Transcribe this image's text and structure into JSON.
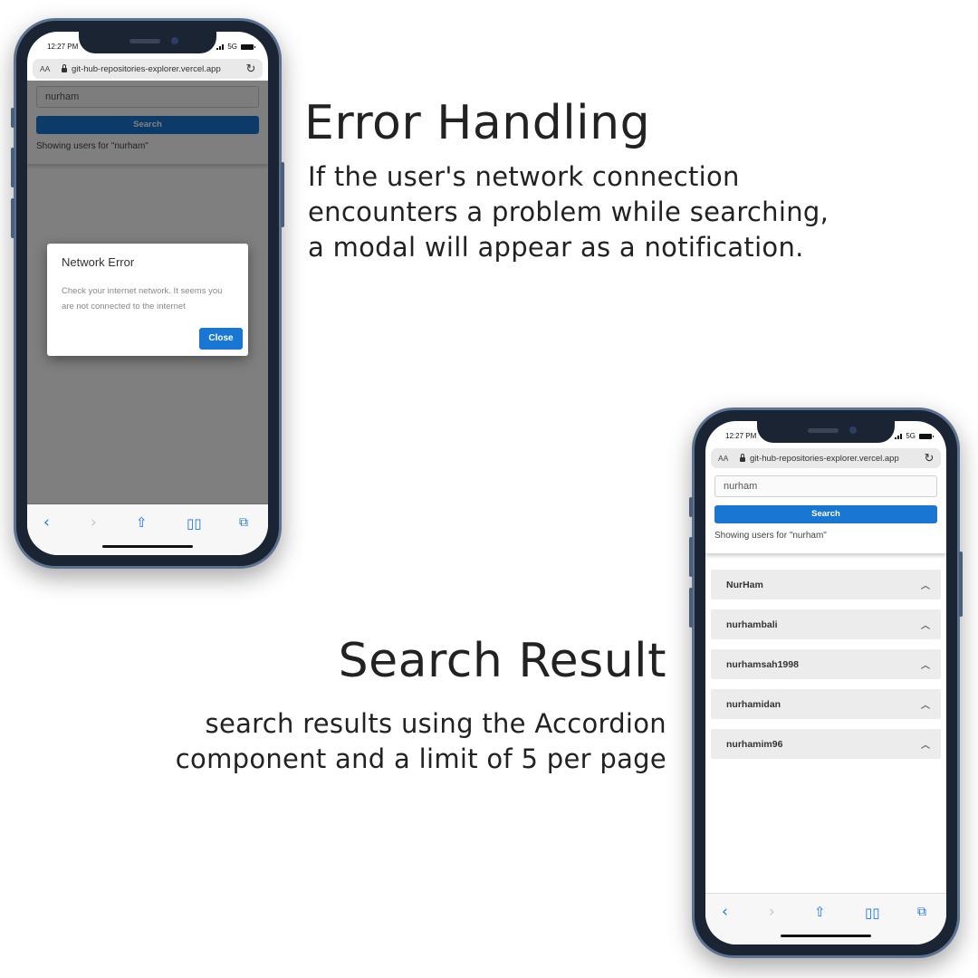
{
  "error_section": {
    "title": "Error Handling",
    "description": "If the user's network connection encounters a problem while searching, a modal will appear as a notification."
  },
  "result_section": {
    "title": "Search Result",
    "description": "search results using the Accordion component and a limit of 5 per page"
  },
  "phone_error": {
    "status": {
      "time": "12:27 PM",
      "network": "5G"
    },
    "browser": {
      "aa": "AA",
      "url": "git-hub-repositories-explorer.vercel.app"
    },
    "search": {
      "value": "nurham",
      "button_label": "Search",
      "showing": "Showing users for \"nurham\""
    },
    "modal": {
      "title": "Network Error",
      "body": "Check your internet network. It seems you are not connected to the internet",
      "close_label": "Close"
    }
  },
  "phone_result": {
    "status": {
      "time": "12:27 PM",
      "network": "5G"
    },
    "browser": {
      "aa": "AA",
      "url": "git-hub-repositories-explorer.vercel.app"
    },
    "search": {
      "value": "nurham",
      "button_label": "Search",
      "showing": "Showing users for \"nurham\""
    },
    "results": [
      {
        "label": "NurHam"
      },
      {
        "label": "nurhambali"
      },
      {
        "label": "nurhamsah1998"
      },
      {
        "label": "nurhamidan"
      },
      {
        "label": "nurhamim96"
      }
    ]
  },
  "icons": {
    "back": "chevron-left-icon",
    "forward": "chevron-right-icon",
    "share": "share-icon",
    "bookmarks": "book-icon",
    "tabs": "tabs-icon",
    "reload": "reload-icon",
    "lock": "lock-icon",
    "accordion": "chevron-up-icon"
  },
  "colors": {
    "primary": "#1976d2",
    "phone_frame": "#1b2433",
    "accordion_bg": "#ececec"
  }
}
